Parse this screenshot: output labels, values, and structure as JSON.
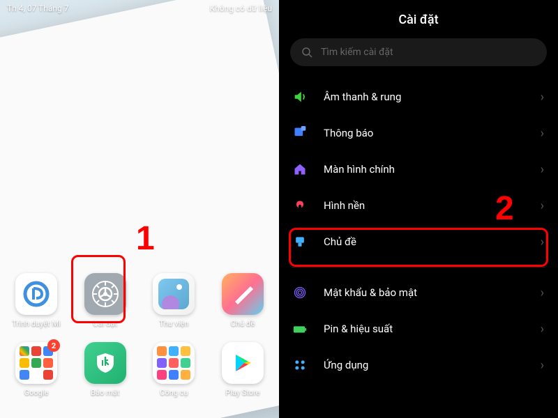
{
  "status_bar": {
    "left": "Th 4, 07 Tháng 7",
    "right": "Không có dữ liệu"
  },
  "apps": {
    "row1": [
      {
        "label": "Trình duyệt Mi"
      },
      {
        "label": "Cài đặt"
      },
      {
        "label": "Thư viện"
      },
      {
        "label": "Chủ đề"
      }
    ],
    "row2": [
      {
        "label": "Google",
        "badge": "2"
      },
      {
        "label": "Bảo mật"
      },
      {
        "label": "Công cụ"
      },
      {
        "label": "Play Store"
      }
    ]
  },
  "settings": {
    "title": "Cài đặt",
    "search_placeholder": "Tìm kiếm cài đặt",
    "items": [
      {
        "label": "Âm thanh & rung",
        "icon": "sound",
        "color": "#40d040"
      },
      {
        "label": "Thông báo",
        "icon": "notification",
        "color": "#4080ff"
      },
      {
        "label": "Màn hình chính",
        "icon": "home",
        "color": "#9060ff"
      },
      {
        "label": "Hình nền",
        "icon": "wallpaper",
        "color": "#ff4060"
      },
      {
        "label": "Chủ đề",
        "icon": "theme",
        "color": "#40b0ff"
      },
      {
        "label": "Mật khẩu & bảo mật",
        "icon": "password",
        "color": "#8060ff"
      },
      {
        "label": "Pin & hiệu suất",
        "icon": "battery",
        "color": "#40d060"
      },
      {
        "label": "Ứng dụng",
        "icon": "apps",
        "color": "#40b0ff"
      }
    ]
  },
  "annotations": {
    "step1": "1",
    "step2": "2"
  }
}
